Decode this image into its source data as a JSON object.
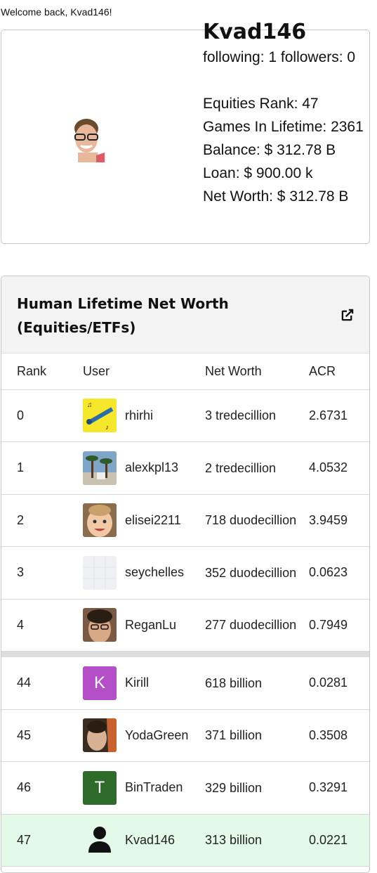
{
  "welcome": "Welcome back, Kvad146!",
  "profile": {
    "username": "Kvad146",
    "follow": "following: 1 followers: 0",
    "equities_rank": "Equities Rank: 47",
    "games": "Games In Lifetime: 2361",
    "balance": "Balance: $ 312.78 B",
    "loan": "Loan: $ 900.00 k",
    "net_worth": "Net Worth: $ 312.78 B"
  },
  "leaderboard": {
    "title": "Human Lifetime Net Worth (Equities/ETFs)",
    "icon": "external-link-icon",
    "columns": [
      "Rank",
      "User",
      "Net Worth",
      "ACR"
    ],
    "rows": [
      {
        "rank": "0",
        "user": "rhirhi",
        "net_worth": "3 tredecillion",
        "acr": "2.6731",
        "avatar": "clarinet-image"
      },
      {
        "rank": "1",
        "user": "alexkpl13",
        "net_worth": "2 tredecillion",
        "acr": "4.0532",
        "avatar": "palm-trees-image"
      },
      {
        "rank": "2",
        "user": "elisei2211",
        "net_worth": "718 duodecillion",
        "acr": "3.9459",
        "avatar": "child-photo"
      },
      {
        "rank": "3",
        "user": "seychelles",
        "net_worth": "352 duodecillion",
        "acr": "0.0623",
        "avatar": "blank-image"
      },
      {
        "rank": "4",
        "user": "ReganLu",
        "net_worth": "277 duodecillion",
        "acr": "0.7949",
        "avatar": "person-photo"
      }
    ],
    "rows_near": [
      {
        "rank": "44",
        "user": "Kirill",
        "net_worth": "618 billion",
        "acr": "0.0281",
        "letter": "K",
        "color": "#b44fc8"
      },
      {
        "rank": "45",
        "user": "YodaGreen",
        "net_worth": "371 billion",
        "acr": "0.3508",
        "avatar": "person-photo"
      },
      {
        "rank": "46",
        "user": "BinTraden",
        "net_worth": "329 billion",
        "acr": "0.3291",
        "letter": "T",
        "color": "#2e6b2a"
      },
      {
        "rank": "47",
        "user": "Kvad146",
        "net_worth": "313 billion",
        "acr": "0.0221",
        "avatar": "person-silhouette-icon",
        "highlight": "#e4fae8"
      }
    ]
  }
}
